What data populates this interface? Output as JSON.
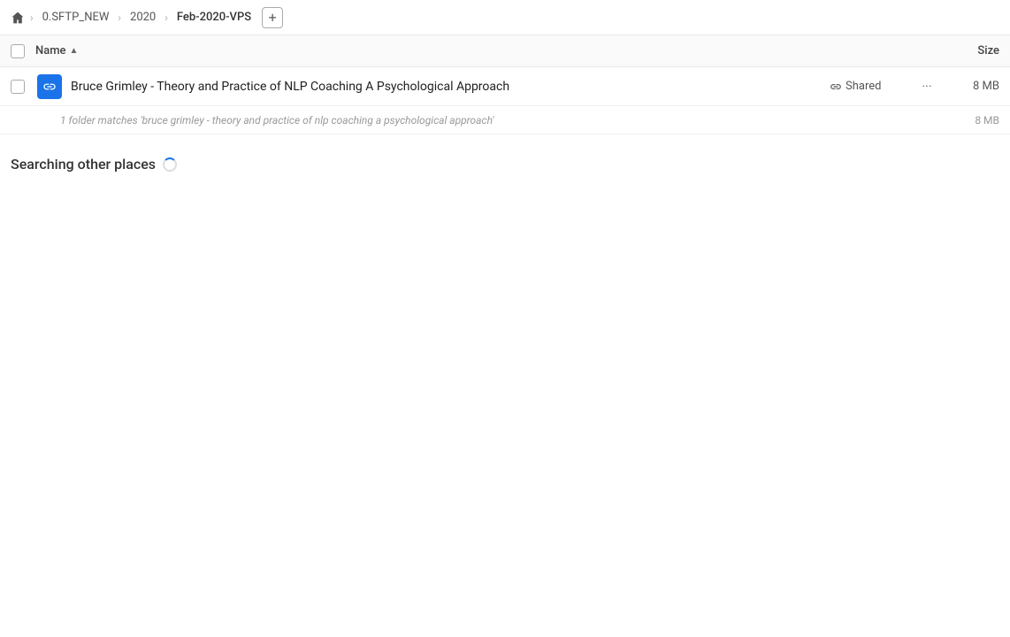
{
  "breadcrumb": {
    "home_label": "Home",
    "items": [
      {
        "label": "0.SFTP_NEW",
        "active": false
      },
      {
        "label": "2020",
        "active": false
      },
      {
        "label": "Feb-2020-VPS",
        "active": true
      }
    ],
    "add_button_label": "+"
  },
  "columns": {
    "name_label": "Name",
    "sort_indicator": "▲",
    "size_label": "Size"
  },
  "file_row": {
    "name": "Bruce Grimley - Theory and Practice of NLP Coaching A Psychological Approach",
    "shared_label": "Shared",
    "more_label": "···",
    "size": "8 MB"
  },
  "match_row": {
    "text": "1 folder matches 'bruce grimley - theory and practice of nlp coaching a psychological approach'",
    "size": "8 MB"
  },
  "searching": {
    "label": "Searching other places"
  }
}
